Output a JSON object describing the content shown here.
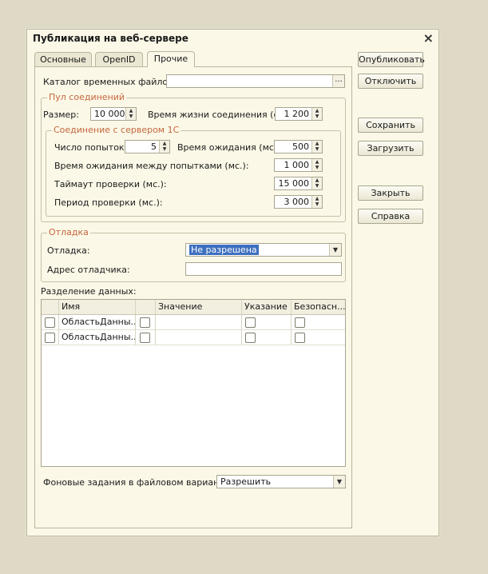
{
  "window": {
    "title": "Публикация на веб-сервере",
    "close_icon": "×"
  },
  "tabs": [
    {
      "label": "Основные"
    },
    {
      "label": "OpenID"
    },
    {
      "label": "Прочие"
    }
  ],
  "temp_dir": {
    "label": "Каталог временных файлов:",
    "value": "",
    "button": "..."
  },
  "pool": {
    "title": "Пул соединений",
    "size_label": "Размер:",
    "size_value": "10 000",
    "lifetime_label": "Время жизни соединения (с.):",
    "lifetime_value": "1 200"
  },
  "connection": {
    "title": "Соединение с сервером 1С",
    "attempts_label": "Число попыток:",
    "attempts_value": "5",
    "wait_label": "Время ожидания (мс.):",
    "wait_value": "500",
    "between_label": "Время ожидания между попытками (мс.):",
    "between_value": "1 000",
    "check_timeout_label": "Таймаут проверки (мс.):",
    "check_timeout_value": "15 000",
    "check_period_label": "Период проверки (мс.):",
    "check_period_value": "3 000"
  },
  "debug": {
    "title": "Отладка",
    "debug_label": "Отладка:",
    "debug_value": "Не разрешена",
    "address_label": "Адрес отладчика:",
    "address_value": ""
  },
  "data_separation": {
    "label": "Разделение данных:",
    "columns": [
      "Имя",
      "Значение",
      "Указание",
      "Безопасн..."
    ],
    "rows": [
      {
        "checked": false,
        "name": "ОбластьДанны...",
        "value_checked": false,
        "value": "",
        "hint_checked": false,
        "safe_checked": false
      },
      {
        "checked": false,
        "name": "ОбластьДанны...",
        "value_checked": false,
        "value": "",
        "hint_checked": false,
        "safe_checked": false
      }
    ]
  },
  "background": {
    "label": "Фоновые задания в файловом варианте:",
    "value": "Разрешить"
  },
  "buttons": {
    "publish": "Опубликовать",
    "disable": "Отключить",
    "save": "Сохранить",
    "load": "Загрузить",
    "close": "Закрыть",
    "help": "Справка"
  }
}
